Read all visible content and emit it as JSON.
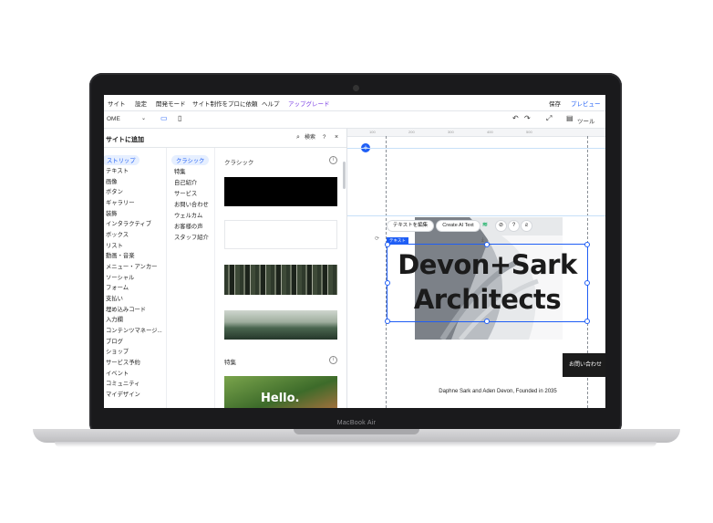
{
  "device": {
    "brand": "MacBook Air"
  },
  "menu": {
    "items": [
      "サイト",
      "設定",
      "開発モード",
      "サイト制作をプロに依頼",
      "ヘルプ",
      "アップグレード"
    ],
    "save": "保存",
    "preview": "プレビュー"
  },
  "toolbar": {
    "page": "OME",
    "tools": "ツール",
    "ruler_ticks": [
      "100",
      "200",
      "300",
      "400",
      "500"
    ]
  },
  "panel": {
    "title": "サイトに追加",
    "search_label": "検索",
    "help": "?",
    "close": "×",
    "categories": [
      "ストリップ",
      "テキスト",
      "画像",
      "ボタン",
      "ギャラリー",
      "装飾",
      "インタラクティブ",
      "ボックス",
      "リスト",
      "動画・音楽",
      "メニュー・アンカー",
      "ソーシャル",
      "フォーム",
      "支払い",
      "埋め込みコード",
      "入力欄",
      "コンテンツマネージ...",
      "ブログ",
      "ショップ",
      "サービス予約",
      "イベント",
      "コミュニティ",
      "マイデザイン"
    ],
    "subcategories": [
      "クラシック",
      "特集",
      "自己紹介",
      "サービス",
      "お問い合わせ",
      "ウェルカム",
      "お客様の声",
      "スタッフ紹介"
    ],
    "section_classic": "クラシック",
    "section_featured": "特集",
    "hello_text": "Hello."
  },
  "canvas": {
    "tag_text": "テキスト",
    "edit_text_button": "テキストを編集",
    "ai_text_button": "Create AI Text",
    "headline_line1": "Devon+Sark",
    "headline_line2": "Architects",
    "cta_label": "お問い合わせ",
    "subtitle": "Daphne Sark and Aden Devon, Founded in 2035"
  },
  "colors": {
    "accent": "#1f5ef5",
    "upgrade": "#7b3fe4",
    "wix_green": "#21b36b"
  }
}
